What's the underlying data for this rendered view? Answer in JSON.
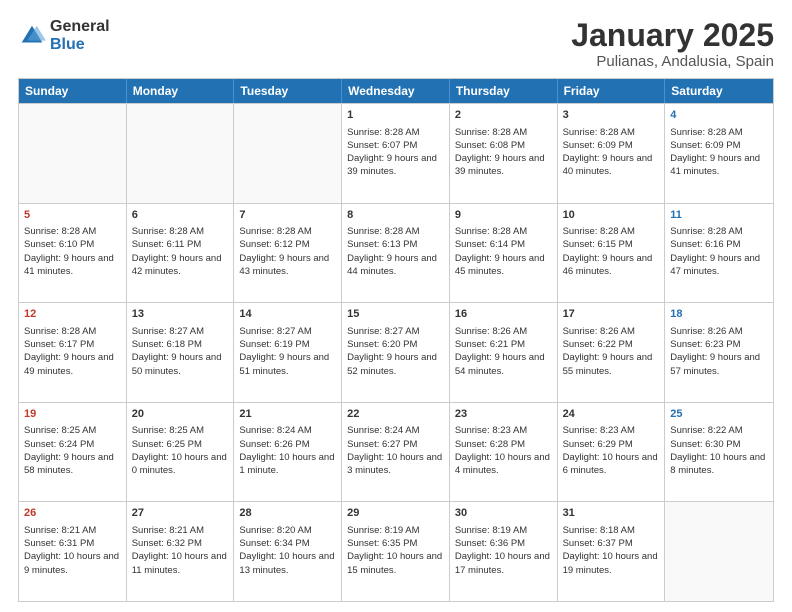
{
  "logo": {
    "general": "General",
    "blue": "Blue"
  },
  "title": "January 2025",
  "subtitle": "Pulianas, Andalusia, Spain",
  "headers": [
    "Sunday",
    "Monday",
    "Tuesday",
    "Wednesday",
    "Thursday",
    "Friday",
    "Saturday"
  ],
  "weeks": [
    [
      {
        "day": "",
        "sunrise": "",
        "sunset": "",
        "daylight": ""
      },
      {
        "day": "",
        "sunrise": "",
        "sunset": "",
        "daylight": ""
      },
      {
        "day": "",
        "sunrise": "",
        "sunset": "",
        "daylight": ""
      },
      {
        "day": "1",
        "sunrise": "Sunrise: 8:28 AM",
        "sunset": "Sunset: 6:07 PM",
        "daylight": "Daylight: 9 hours and 39 minutes."
      },
      {
        "day": "2",
        "sunrise": "Sunrise: 8:28 AM",
        "sunset": "Sunset: 6:08 PM",
        "daylight": "Daylight: 9 hours and 39 minutes."
      },
      {
        "day": "3",
        "sunrise": "Sunrise: 8:28 AM",
        "sunset": "Sunset: 6:09 PM",
        "daylight": "Daylight: 9 hours and 40 minutes."
      },
      {
        "day": "4",
        "sunrise": "Sunrise: 8:28 AM",
        "sunset": "Sunset: 6:09 PM",
        "daylight": "Daylight: 9 hours and 41 minutes."
      }
    ],
    [
      {
        "day": "5",
        "sunrise": "Sunrise: 8:28 AM",
        "sunset": "Sunset: 6:10 PM",
        "daylight": "Daylight: 9 hours and 41 minutes."
      },
      {
        "day": "6",
        "sunrise": "Sunrise: 8:28 AM",
        "sunset": "Sunset: 6:11 PM",
        "daylight": "Daylight: 9 hours and 42 minutes."
      },
      {
        "day": "7",
        "sunrise": "Sunrise: 8:28 AM",
        "sunset": "Sunset: 6:12 PM",
        "daylight": "Daylight: 9 hours and 43 minutes."
      },
      {
        "day": "8",
        "sunrise": "Sunrise: 8:28 AM",
        "sunset": "Sunset: 6:13 PM",
        "daylight": "Daylight: 9 hours and 44 minutes."
      },
      {
        "day": "9",
        "sunrise": "Sunrise: 8:28 AM",
        "sunset": "Sunset: 6:14 PM",
        "daylight": "Daylight: 9 hours and 45 minutes."
      },
      {
        "day": "10",
        "sunrise": "Sunrise: 8:28 AM",
        "sunset": "Sunset: 6:15 PM",
        "daylight": "Daylight: 9 hours and 46 minutes."
      },
      {
        "day": "11",
        "sunrise": "Sunrise: 8:28 AM",
        "sunset": "Sunset: 6:16 PM",
        "daylight": "Daylight: 9 hours and 47 minutes."
      }
    ],
    [
      {
        "day": "12",
        "sunrise": "Sunrise: 8:28 AM",
        "sunset": "Sunset: 6:17 PM",
        "daylight": "Daylight: 9 hours and 49 minutes."
      },
      {
        "day": "13",
        "sunrise": "Sunrise: 8:27 AM",
        "sunset": "Sunset: 6:18 PM",
        "daylight": "Daylight: 9 hours and 50 minutes."
      },
      {
        "day": "14",
        "sunrise": "Sunrise: 8:27 AM",
        "sunset": "Sunset: 6:19 PM",
        "daylight": "Daylight: 9 hours and 51 minutes."
      },
      {
        "day": "15",
        "sunrise": "Sunrise: 8:27 AM",
        "sunset": "Sunset: 6:20 PM",
        "daylight": "Daylight: 9 hours and 52 minutes."
      },
      {
        "day": "16",
        "sunrise": "Sunrise: 8:26 AM",
        "sunset": "Sunset: 6:21 PM",
        "daylight": "Daylight: 9 hours and 54 minutes."
      },
      {
        "day": "17",
        "sunrise": "Sunrise: 8:26 AM",
        "sunset": "Sunset: 6:22 PM",
        "daylight": "Daylight: 9 hours and 55 minutes."
      },
      {
        "day": "18",
        "sunrise": "Sunrise: 8:26 AM",
        "sunset": "Sunset: 6:23 PM",
        "daylight": "Daylight: 9 hours and 57 minutes."
      }
    ],
    [
      {
        "day": "19",
        "sunrise": "Sunrise: 8:25 AM",
        "sunset": "Sunset: 6:24 PM",
        "daylight": "Daylight: 9 hours and 58 minutes."
      },
      {
        "day": "20",
        "sunrise": "Sunrise: 8:25 AM",
        "sunset": "Sunset: 6:25 PM",
        "daylight": "Daylight: 10 hours and 0 minutes."
      },
      {
        "day": "21",
        "sunrise": "Sunrise: 8:24 AM",
        "sunset": "Sunset: 6:26 PM",
        "daylight": "Daylight: 10 hours and 1 minute."
      },
      {
        "day": "22",
        "sunrise": "Sunrise: 8:24 AM",
        "sunset": "Sunset: 6:27 PM",
        "daylight": "Daylight: 10 hours and 3 minutes."
      },
      {
        "day": "23",
        "sunrise": "Sunrise: 8:23 AM",
        "sunset": "Sunset: 6:28 PM",
        "daylight": "Daylight: 10 hours and 4 minutes."
      },
      {
        "day": "24",
        "sunrise": "Sunrise: 8:23 AM",
        "sunset": "Sunset: 6:29 PM",
        "daylight": "Daylight: 10 hours and 6 minutes."
      },
      {
        "day": "25",
        "sunrise": "Sunrise: 8:22 AM",
        "sunset": "Sunset: 6:30 PM",
        "daylight": "Daylight: 10 hours and 8 minutes."
      }
    ],
    [
      {
        "day": "26",
        "sunrise": "Sunrise: 8:21 AM",
        "sunset": "Sunset: 6:31 PM",
        "daylight": "Daylight: 10 hours and 9 minutes."
      },
      {
        "day": "27",
        "sunrise": "Sunrise: 8:21 AM",
        "sunset": "Sunset: 6:32 PM",
        "daylight": "Daylight: 10 hours and 11 minutes."
      },
      {
        "day": "28",
        "sunrise": "Sunrise: 8:20 AM",
        "sunset": "Sunset: 6:34 PM",
        "daylight": "Daylight: 10 hours and 13 minutes."
      },
      {
        "day": "29",
        "sunrise": "Sunrise: 8:19 AM",
        "sunset": "Sunset: 6:35 PM",
        "daylight": "Daylight: 10 hours and 15 minutes."
      },
      {
        "day": "30",
        "sunrise": "Sunrise: 8:19 AM",
        "sunset": "Sunset: 6:36 PM",
        "daylight": "Daylight: 10 hours and 17 minutes."
      },
      {
        "day": "31",
        "sunrise": "Sunrise: 8:18 AM",
        "sunset": "Sunset: 6:37 PM",
        "daylight": "Daylight: 10 hours and 19 minutes."
      },
      {
        "day": "",
        "sunrise": "",
        "sunset": "",
        "daylight": ""
      }
    ]
  ]
}
